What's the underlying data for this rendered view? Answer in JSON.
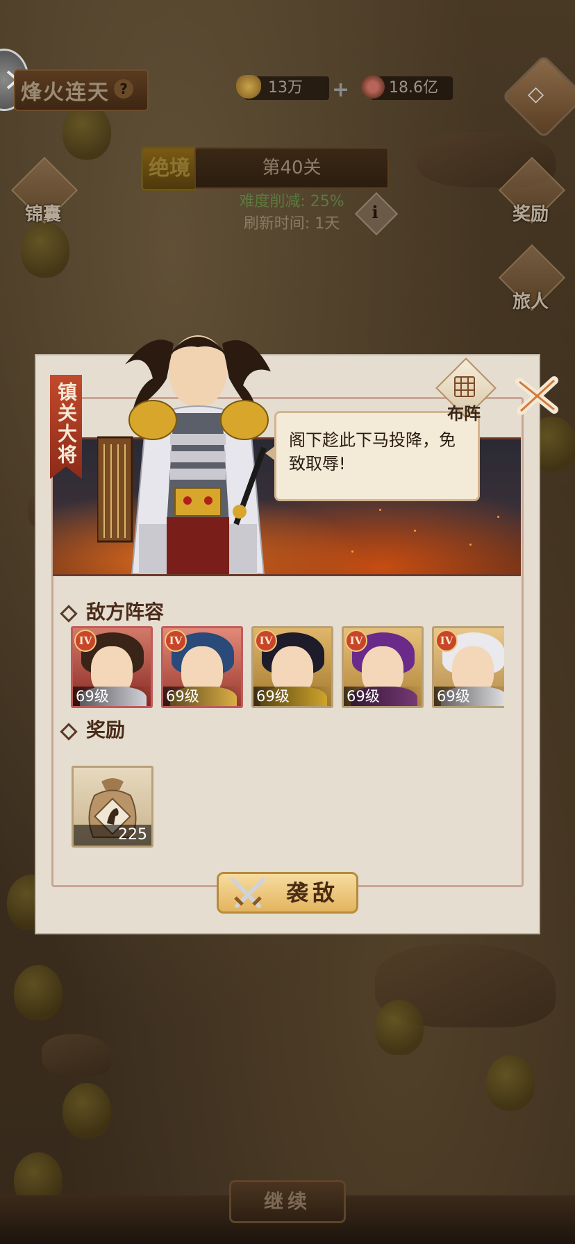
{
  "header": {
    "title": "烽火连天",
    "help_symbol": "?",
    "silver": "13万",
    "copper": "18.6亿",
    "plus_symbol": "+"
  },
  "stage": {
    "mode": "绝境",
    "name": "第40关",
    "difficulty": "难度削减: 25%",
    "refresh": "刷新时间: 1天",
    "info_symbol": "i"
  },
  "side_buttons": {
    "left": "锦囊",
    "rewards": "奖励",
    "traveler": "旅人"
  },
  "dialog": {
    "ribbon": "镇关大将",
    "formation": "布阵",
    "speech": "阁下趁此下马投降，免致取辱!",
    "enemy_title": "敌方阵容",
    "reward_title": "奖励",
    "attack": "袭敌",
    "heroes": [
      {
        "tier": "IV",
        "level": "69级"
      },
      {
        "tier": "IV",
        "level": "69级"
      },
      {
        "tier": "IV",
        "level": "69级"
      },
      {
        "tier": "IV",
        "level": "69级"
      },
      {
        "tier": "IV",
        "level": "69级"
      }
    ],
    "reward": {
      "icon": "horse-feed-bag-icon",
      "count": "225"
    }
  },
  "footer": {
    "continue": "继续"
  },
  "colors": {
    "accent_gold": "#e3b45e",
    "ribbon_red": "#c24a2c",
    "panel": "#e4ddd0"
  }
}
